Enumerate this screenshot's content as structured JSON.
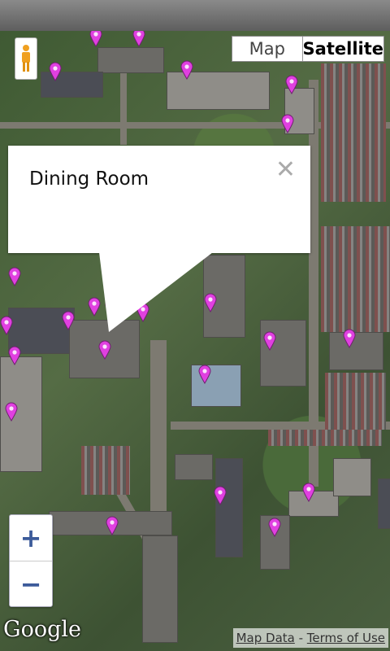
{
  "map_type_control": {
    "map_label": "Map",
    "satellite_label": "Satellite",
    "selected": "Satellite"
  },
  "info_window": {
    "title": "Dining Room",
    "close_symbol": "✕"
  },
  "zoom": {
    "in_label": "+",
    "out_label": "−"
  },
  "logo": {
    "text": "Google"
  },
  "attribution": {
    "map_data": "Map Data",
    "separator": " - ",
    "terms": "Terms of Use"
  },
  "marker_color": "#e040e0",
  "icons": {
    "street_view": "pegman-icon",
    "marker": "map-marker-icon"
  }
}
